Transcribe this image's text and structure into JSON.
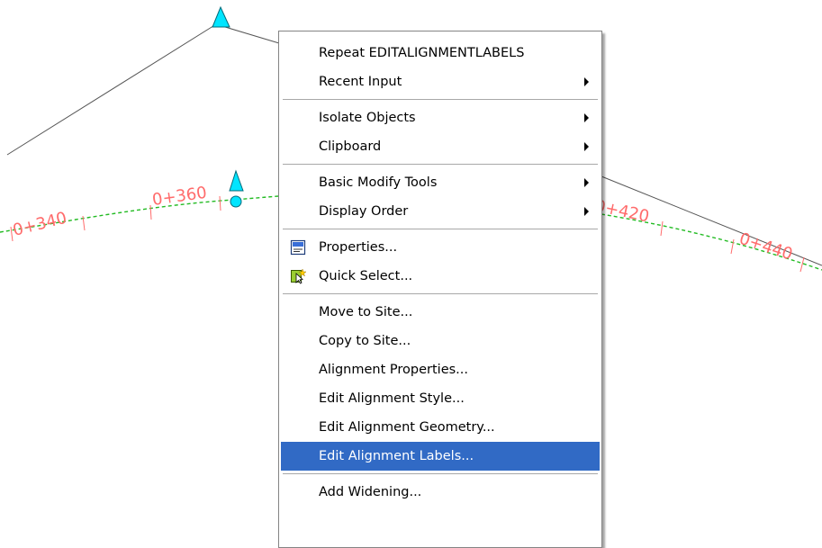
{
  "drawing": {
    "stations": [
      "0+340",
      "0+360",
      "0+420",
      "0+440"
    ]
  },
  "menu": {
    "items": [
      {
        "label": "Repeat EDITALIGNMENTLABELS",
        "submenu": false
      },
      {
        "label": "Recent Input",
        "submenu": true
      },
      {
        "label": "Isolate Objects",
        "submenu": true
      },
      {
        "label": "Clipboard",
        "submenu": true
      },
      {
        "label": "Basic Modify Tools",
        "submenu": true
      },
      {
        "label": "Display Order",
        "submenu": true
      },
      {
        "label": "Properties...",
        "icon": "properties-icon"
      },
      {
        "label": "Quick Select...",
        "icon": "quick-select-icon"
      },
      {
        "label": "Move to Site..."
      },
      {
        "label": "Copy to Site..."
      },
      {
        "label": "Alignment Properties..."
      },
      {
        "label": "Edit Alignment Style..."
      },
      {
        "label": "Edit Alignment Geometry..."
      },
      {
        "label": "Edit Alignment Labels...",
        "highlighted": true
      },
      {
        "label": "Add Widening..."
      }
    ]
  },
  "colors": {
    "highlight": "#316ac5",
    "station_label": "#ff6b6b",
    "alignment": "#00aa00",
    "marker": "#00ffff"
  }
}
